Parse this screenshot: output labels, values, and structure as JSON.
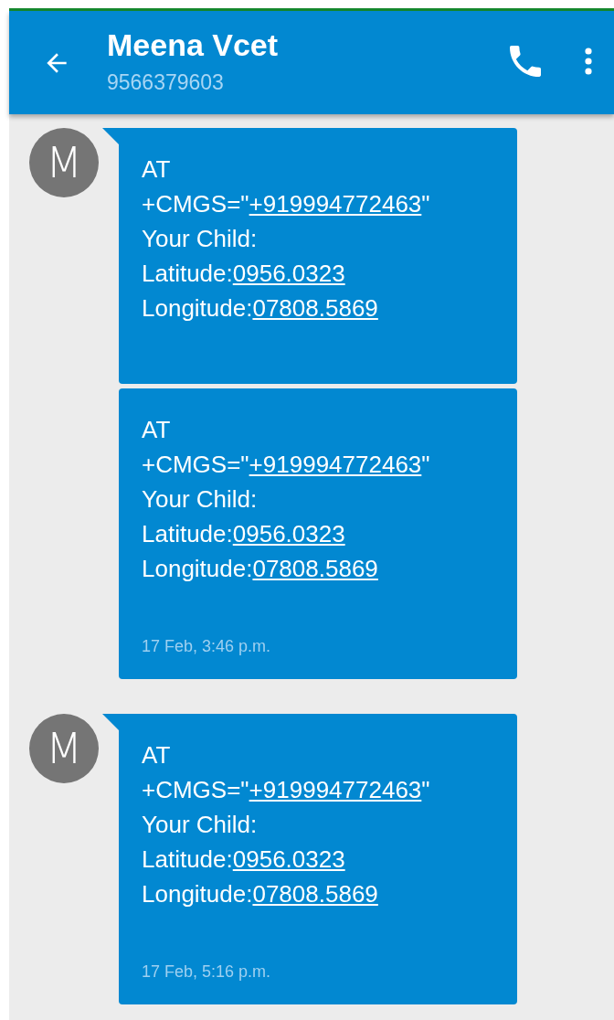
{
  "header": {
    "title": "Meena Vcet",
    "subtitle": "9566379603"
  },
  "groups": [
    {
      "avatar": "M",
      "messages": [
        {
          "lines": [
            [
              {
                "text": "AT",
                "link": false
              }
            ],
            [
              {
                "text": "+CMGS=\"",
                "link": false
              },
              {
                "text": "+919994772463",
                "link": true
              },
              {
                "text": "\"",
                "link": false
              }
            ],
            [
              {
                "text": "Your Child:",
                "link": false
              }
            ],
            [
              {
                "text": "Latitude:",
                "link": false
              },
              {
                "text": "0956.0323",
                "link": true
              }
            ],
            [
              {
                "text": "Longitude:",
                "link": false
              },
              {
                "text": "07808.5869",
                "link": true
              }
            ]
          ]
        },
        {
          "lines": [
            [
              {
                "text": "AT",
                "link": false
              }
            ],
            [
              {
                "text": "+CMGS=\"",
                "link": false
              },
              {
                "text": "+919994772463",
                "link": true
              },
              {
                "text": "\"",
                "link": false
              }
            ],
            [
              {
                "text": "Your Child:",
                "link": false
              }
            ],
            [
              {
                "text": "Latitude:",
                "link": false
              },
              {
                "text": "0956.0323",
                "link": true
              }
            ],
            [
              {
                "text": "Longitude:",
                "link": false
              },
              {
                "text": "07808.5869",
                "link": true
              }
            ]
          ],
          "time": "17 Feb, 3:46 p.m."
        }
      ]
    },
    {
      "avatar": "M",
      "messages": [
        {
          "lines": [
            [
              {
                "text": "AT",
                "link": false
              }
            ],
            [
              {
                "text": "+CMGS=\"",
                "link": false
              },
              {
                "text": "+919994772463",
                "link": true
              },
              {
                "text": "\"",
                "link": false
              }
            ],
            [
              {
                "text": "Your Child:",
                "link": false
              }
            ],
            [
              {
                "text": "Latitude:",
                "link": false
              },
              {
                "text": "0956.0323",
                "link": true
              }
            ],
            [
              {
                "text": "Longitude:",
                "link": false
              },
              {
                "text": "07808.5869",
                "link": true
              }
            ]
          ],
          "time": "17 Feb, 5:16 p.m."
        }
      ]
    }
  ]
}
